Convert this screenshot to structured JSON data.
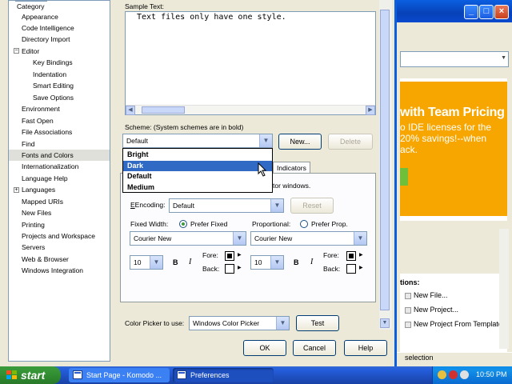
{
  "background_window": {
    "ad_headline": "with Team Pricing",
    "ad_body": "o IDE licenses for the\n20% savings!--when\nack.",
    "actions_header": "tions:",
    "actions": [
      "New File...",
      "New Project...",
      "New Project From Template..."
    ],
    "status_text": "selection"
  },
  "tree": {
    "items": [
      {
        "label": "Category"
      },
      {
        "label": "Appearance"
      },
      {
        "label": "Code Intelligence"
      },
      {
        "label": "Directory Import"
      },
      {
        "label": "Editor",
        "expander": "−"
      },
      {
        "label": "Key Bindings"
      },
      {
        "label": "Indentation"
      },
      {
        "label": "Smart Editing"
      },
      {
        "label": "Save Options"
      },
      {
        "label": "Environment"
      },
      {
        "label": "Fast Open"
      },
      {
        "label": "File Associations"
      },
      {
        "label": "Find"
      },
      {
        "label": "Fonts and Colors",
        "selected": true
      },
      {
        "label": "Internationalization"
      },
      {
        "label": "Language Help"
      },
      {
        "label": "Languages",
        "expander": "+"
      },
      {
        "label": "Mapped URIs"
      },
      {
        "label": "New Files"
      },
      {
        "label": "Printing"
      },
      {
        "label": "Projects and Workspace"
      },
      {
        "label": "Servers"
      },
      {
        "label": "Web & Browser"
      },
      {
        "label": "Windows Integration"
      }
    ]
  },
  "sample": {
    "label": "Sample Text:",
    "text": "Text files only have one style."
  },
  "scheme": {
    "label": "Scheme: (System schemes are in bold)",
    "selected": "Default",
    "new_button": "New...",
    "delete_button": "Delete",
    "options": [
      "Bright",
      "Dark",
      "Default",
      "Medium"
    ],
    "highlighted": "Dark"
  },
  "tabs": {
    "indicators": "Indicators",
    "partial_text": "tor windows."
  },
  "encoding": {
    "label": "Encoding:",
    "value": "Default",
    "reset_button": "Reset"
  },
  "fixed": {
    "label": "Fixed Width:",
    "prefer_label": "Prefer Fixed",
    "font": "Courier New",
    "size": "10",
    "bold": "B",
    "italic": "I",
    "fore_label": "Fore:",
    "back_label": "Back:"
  },
  "proportional": {
    "label": "Proportional:",
    "prefer_label": "Prefer Prop.",
    "font": "Courier New",
    "size": "10",
    "bold": "B",
    "italic": "I",
    "fore_label": "Fore:",
    "back_label": "Back:"
  },
  "color_picker": {
    "label": "Color Picker to use:",
    "value": "Windows Color Picker",
    "test_button": "Test"
  },
  "dialog_buttons": {
    "ok": "OK",
    "cancel": "Cancel",
    "help": "Help"
  },
  "taskbar": {
    "start": "start",
    "tasks": [
      "Start Page - Komodo ...",
      "Preferences"
    ],
    "clock": "10:50 PM"
  }
}
